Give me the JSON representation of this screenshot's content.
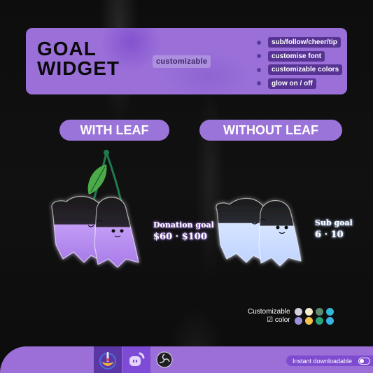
{
  "header": {
    "title_line1": "GOAL",
    "title_line2": "WIDGET",
    "tag": "customizable",
    "features": [
      "sub/follow/cheer/tip",
      "customise font",
      "customizable colors",
      "glow on / off"
    ]
  },
  "variants": [
    {
      "label": "WITH LEAF",
      "goal_label": "Donation goal",
      "goal_value": "$60 · $100",
      "ghost_color": "#b48af0"
    },
    {
      "label": "WITHOUT LEAF",
      "goal_label": "Sub goal",
      "goal_value": "6 · 10",
      "ghost_color": "#cfe0ff"
    }
  ],
  "palette": {
    "line1": "Customizable",
    "line2": "color",
    "checkbox_icon": "checkbox-icon",
    "colors": [
      "#d6cde0",
      "#f2ecd0",
      "#5d8a6f",
      "#2fb8d8",
      "#9a90dc",
      "#f3c24a",
      "#27a47a",
      "#38b2e4"
    ]
  },
  "footer": {
    "platforms": [
      "streamelements-icon",
      "twitch-icon",
      "obs-icon"
    ],
    "download_label": "Instant downloadable"
  },
  "colors": {
    "accent": "#9b74d9",
    "dark_accent": "#573493"
  }
}
